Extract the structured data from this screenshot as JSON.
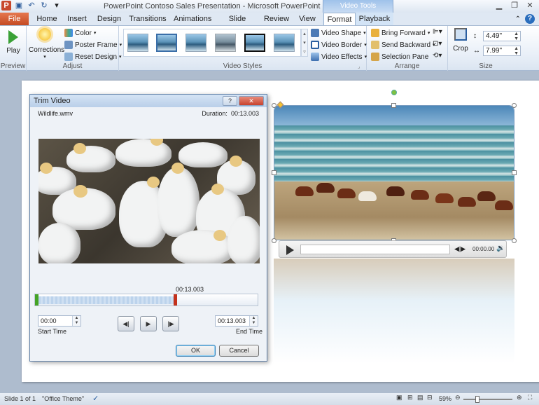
{
  "window": {
    "title": "PowerPoint Contoso Sales Presentation  -  Microsoft PowerPoint",
    "context_tab_title": "Video Tools"
  },
  "tabs": [
    "File",
    "Home",
    "Insert",
    "Design",
    "Transitions",
    "Animations",
    "Slide Show",
    "Review",
    "View",
    "Format",
    "Playback"
  ],
  "active_tab": "Format",
  "ribbon": {
    "preview": {
      "play_label": "Play",
      "group_label": "Preview"
    },
    "adjust": {
      "corrections_label": "Corrections",
      "color_label": "Color",
      "poster_frame_label": "Poster Frame",
      "reset_design_label": "Reset Design",
      "group_label": "Adjust"
    },
    "video_styles": {
      "group_label": "Video Styles"
    },
    "video_effects": {
      "shape_label": "Video Shape",
      "border_label": "Video Border",
      "effects_label": "Video Effects"
    },
    "arrange": {
      "bring_forward_label": "Bring Forward",
      "send_backward_label": "Send Backward",
      "selection_pane_label": "Selection Pane",
      "group_label": "Arrange"
    },
    "size": {
      "crop_label": "Crop",
      "height_value": "4.49\"",
      "width_value": "7.99\"",
      "group_label": "Size"
    }
  },
  "trim_dialog": {
    "title": "Trim Video",
    "file_name": "Wildlife.wmv",
    "duration_label": "Duration:",
    "duration_value": "00:13.003",
    "marker_time": "00:13.003",
    "start_time_value": "00:00",
    "start_time_label": "Start Time",
    "end_time_value": "00:13.003",
    "end_time_label": "End Time",
    "ok_label": "OK",
    "cancel_label": "Cancel"
  },
  "video_player": {
    "time": "00:00.00"
  },
  "status_bar": {
    "slide_info": "Slide 1 of 1",
    "theme": "\"Office Theme\"",
    "zoom": "59%"
  }
}
